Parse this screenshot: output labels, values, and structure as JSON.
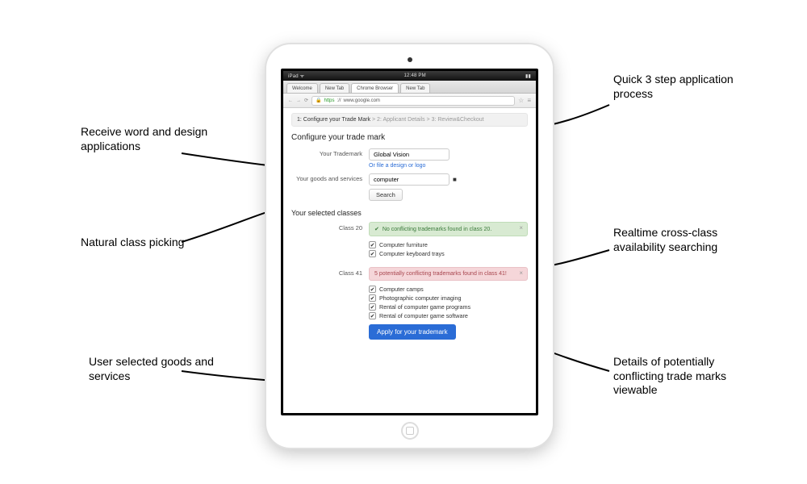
{
  "ios_bar": {
    "left": "iPad ᯤ",
    "center": "12:48 PM",
    "right": "▮▮"
  },
  "browser": {
    "tabs": [
      {
        "label": "Welcome"
      },
      {
        "label": "New Tab"
      },
      {
        "label": "Chrome Browser"
      },
      {
        "label": "New Tab"
      }
    ],
    "url_host": "www.google.com"
  },
  "steps": {
    "s1": "1: Configure your Trade Mark",
    "s2": "2: Applicant Details",
    "s3": "3: Review&Checkout",
    "sep": ">"
  },
  "headings": {
    "configure": "Configure your trade mark",
    "selected": "Your selected classes"
  },
  "form": {
    "trademark_label": "Your Trademark",
    "trademark_value": "Global Vision",
    "design_link": "Or file a design or logo",
    "goods_label": "Your goods and services",
    "goods_value": "computer",
    "search_btn": "Search"
  },
  "classes": [
    {
      "label": "Class 20",
      "alert_type": "ok",
      "alert_text": "No conflicting trademarks found in class 20.",
      "items": [
        "Computer furniture",
        "Computer keyboard trays"
      ]
    },
    {
      "label": "Class 41",
      "alert_type": "warn",
      "alert_text": "5 potentially conflicting trademarks found in class 41!",
      "items": [
        "Computer camps",
        "Photographic computer imaging",
        "Rental of computer game programs",
        "Rental of computer game software"
      ]
    }
  ],
  "apply_btn": "Apply for your trademark",
  "annotations": {
    "a1": "Receive word and design applications",
    "a2": "Natural class picking",
    "a3": "User selected goods and services",
    "a4": "Quick 3 step application process",
    "a5": "Realtime cross-class availability searching",
    "a6": "Details of potentially conflicting trade marks viewable"
  }
}
